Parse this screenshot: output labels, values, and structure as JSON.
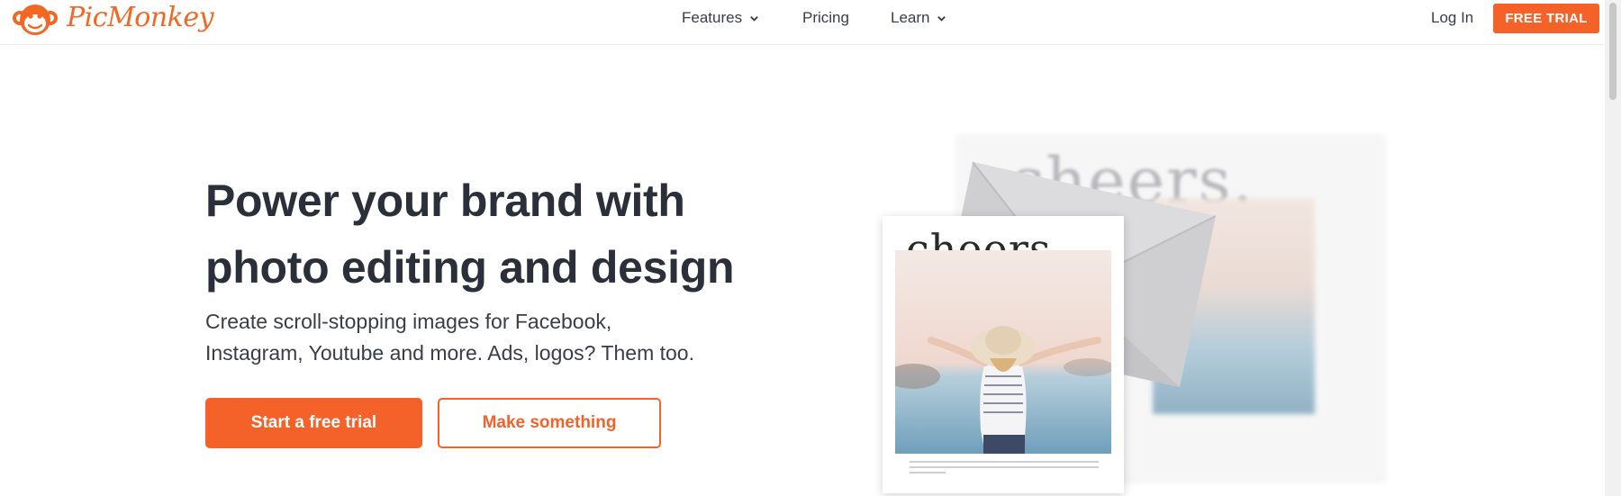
{
  "header": {
    "logo_text": "PicMonkey",
    "nav": {
      "features": "Features",
      "pricing": "Pricing",
      "learn": "Learn"
    },
    "login": "Log In",
    "free_trial": "FREE TRIAL"
  },
  "hero": {
    "title_line1": "Power your brand with",
    "title_line2": "photo editing and design",
    "subtitle_line1": "Create scroll-stopping images for Facebook,",
    "subtitle_line2": "Instagram, Youtube and more. Ads, logos? Them too.",
    "primary_button": "Start a free trial",
    "secondary_button": "Make something"
  },
  "illustration": {
    "card_title": "cheers.",
    "background_title": "cheers."
  },
  "colors": {
    "brand_orange": "#f4622a",
    "text_dark": "#2b2f3a"
  }
}
